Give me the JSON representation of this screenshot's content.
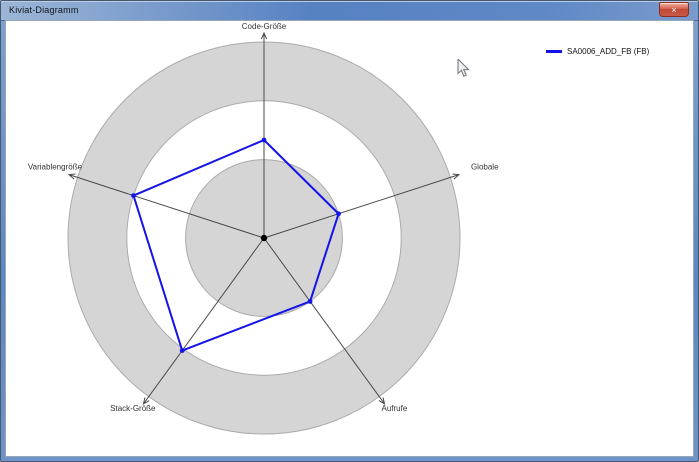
{
  "window": {
    "title": "Kiviat-Diagramm",
    "close_glyph": "×"
  },
  "legend": {
    "items": [
      {
        "label": "SA0006_ADD_FB (FB)",
        "color": "#1414e8"
      }
    ]
  },
  "icons": {
    "close": "close-icon",
    "cursor": "mouse-cursor-icon",
    "axis_arrow": "axis-arrow-icon"
  },
  "chart_data": {
    "type": "radar",
    "title": "",
    "axes": [
      "Code-Größe",
      "Globale",
      "Aufrufe",
      "Stack-Größe",
      "Variablengröße"
    ],
    "series": [
      {
        "name": "SA0006_ADD_FB (FB)",
        "color": "#1414e8",
        "values_fraction_of_outer_ring": [
          0.5,
          0.4,
          0.4,
          0.71,
          0.7
        ]
      }
    ],
    "rings": {
      "inner_circle_fraction": 0.4,
      "band_inner_fraction": 0.7,
      "band_outer_fraction": 1.0,
      "fill": "#d5d5d5",
      "edge": "#ababab"
    },
    "axis_color": "#4a4a4a",
    "center_dot_color": "#000000",
    "legend_position": "top-right",
    "grid": "concentric-rings"
  }
}
